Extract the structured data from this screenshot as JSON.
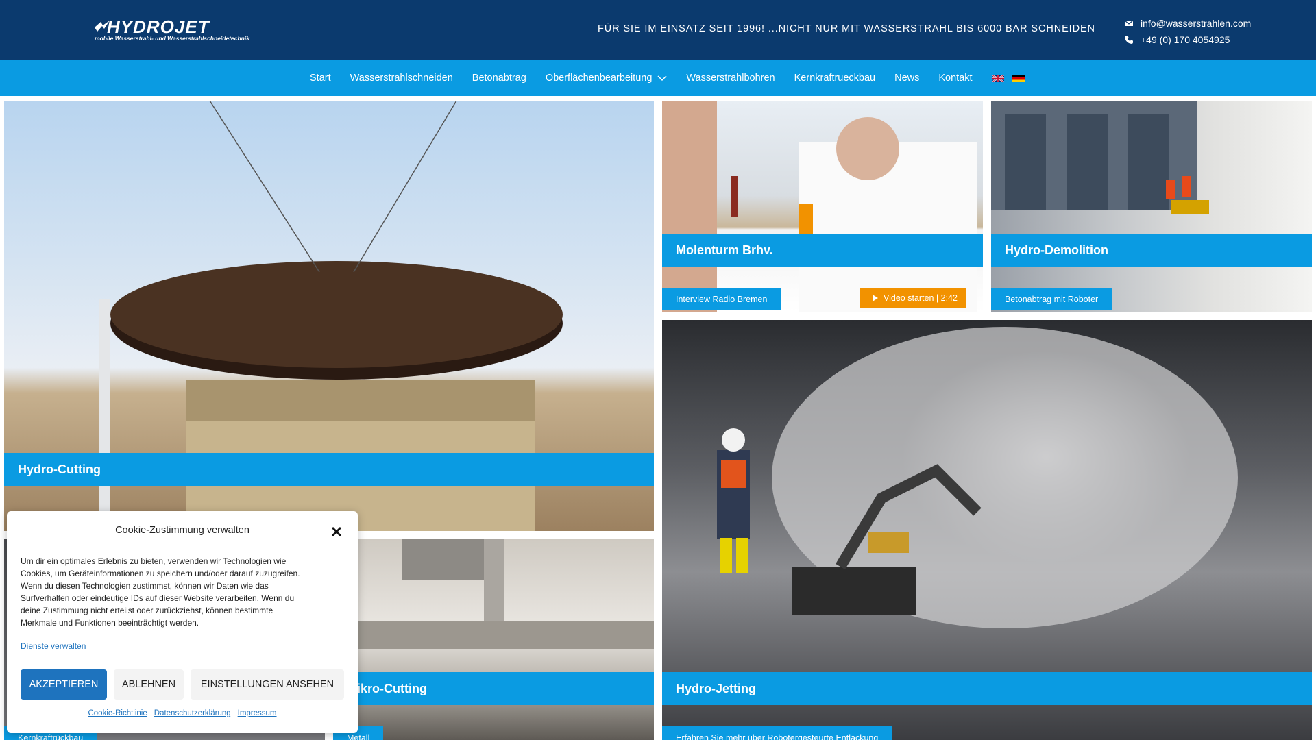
{
  "header": {
    "logo_word": "HYDROJET",
    "logo_sub": "mobile Wasserstrahl- und Wasserstrahlschneidetechnik",
    "tagline": "FÜR SIE IM EINSATZ SEIT 1996! ...NICHT NUR MIT WASSERSTRAHL BIS 6000 BAR SCHNEIDEN",
    "email": "info@wasserstrahlen.com",
    "phone": "+49 (0) 170 4054925"
  },
  "nav": {
    "items": [
      "Start",
      "Wasserstrahlschneiden",
      "Betonabtrag",
      "Oberflächenbearbeitung",
      "Wasserstrahlbohren",
      "Kernkraftrueckbau",
      "News",
      "Kontakt"
    ],
    "languages": [
      "en-flag-icon",
      "de-flag-icon"
    ]
  },
  "tiles": {
    "cutting": {
      "title": "Hydro-Cutting",
      "tag": ""
    },
    "interview": {
      "title": "Molenturm Brhv.",
      "tag": "Interview Radio Bremen",
      "video": "Video starten | 2:42"
    },
    "demolition": {
      "title": "Hydro-Demolition",
      "tag": "Betonabtrag mit Roboter"
    },
    "jetting": {
      "title": "Hydro-Jetting",
      "tag": "Erfahren Sie mehr über Robotergesteurte Entlackung"
    },
    "mikro": {
      "title": "Mikro-Cutting",
      "tag": "Metall"
    },
    "kern": {
      "title": "",
      "tag": "Kernkraftrückbau"
    }
  },
  "cookie": {
    "title": "Cookie-Zustimmung verwalten",
    "body": "Um dir ein optimales Erlebnis zu bieten, verwenden wir Technologien wie Cookies, um Geräteinformationen zu speichern und/oder darauf zuzugreifen. Wenn du diesen Technologien zustimmst, können wir Daten wie das Surfverhalten oder eindeutige IDs auf dieser Website verarbeiten. Wenn du deine Zustimmung nicht erteilst oder zurückziehst, können bestimmte Merkmale und Funktionen beeinträchtigt werden.",
    "manage_label": "Dienste verwalten",
    "accept_label": "AKZEPTIEREN",
    "deny_label": "ABLEHNEN",
    "view_label": "EINSTELLUNGEN ANSEHEN",
    "links": [
      "Cookie-Richtlinie",
      "Datenschutzerklärung",
      "Impressum"
    ]
  },
  "colors": {
    "header_bg": "#0b3a6e",
    "accent_blue": "#0a9be2",
    "video_orange": "#f29200",
    "button_blue": "#1e73be"
  }
}
